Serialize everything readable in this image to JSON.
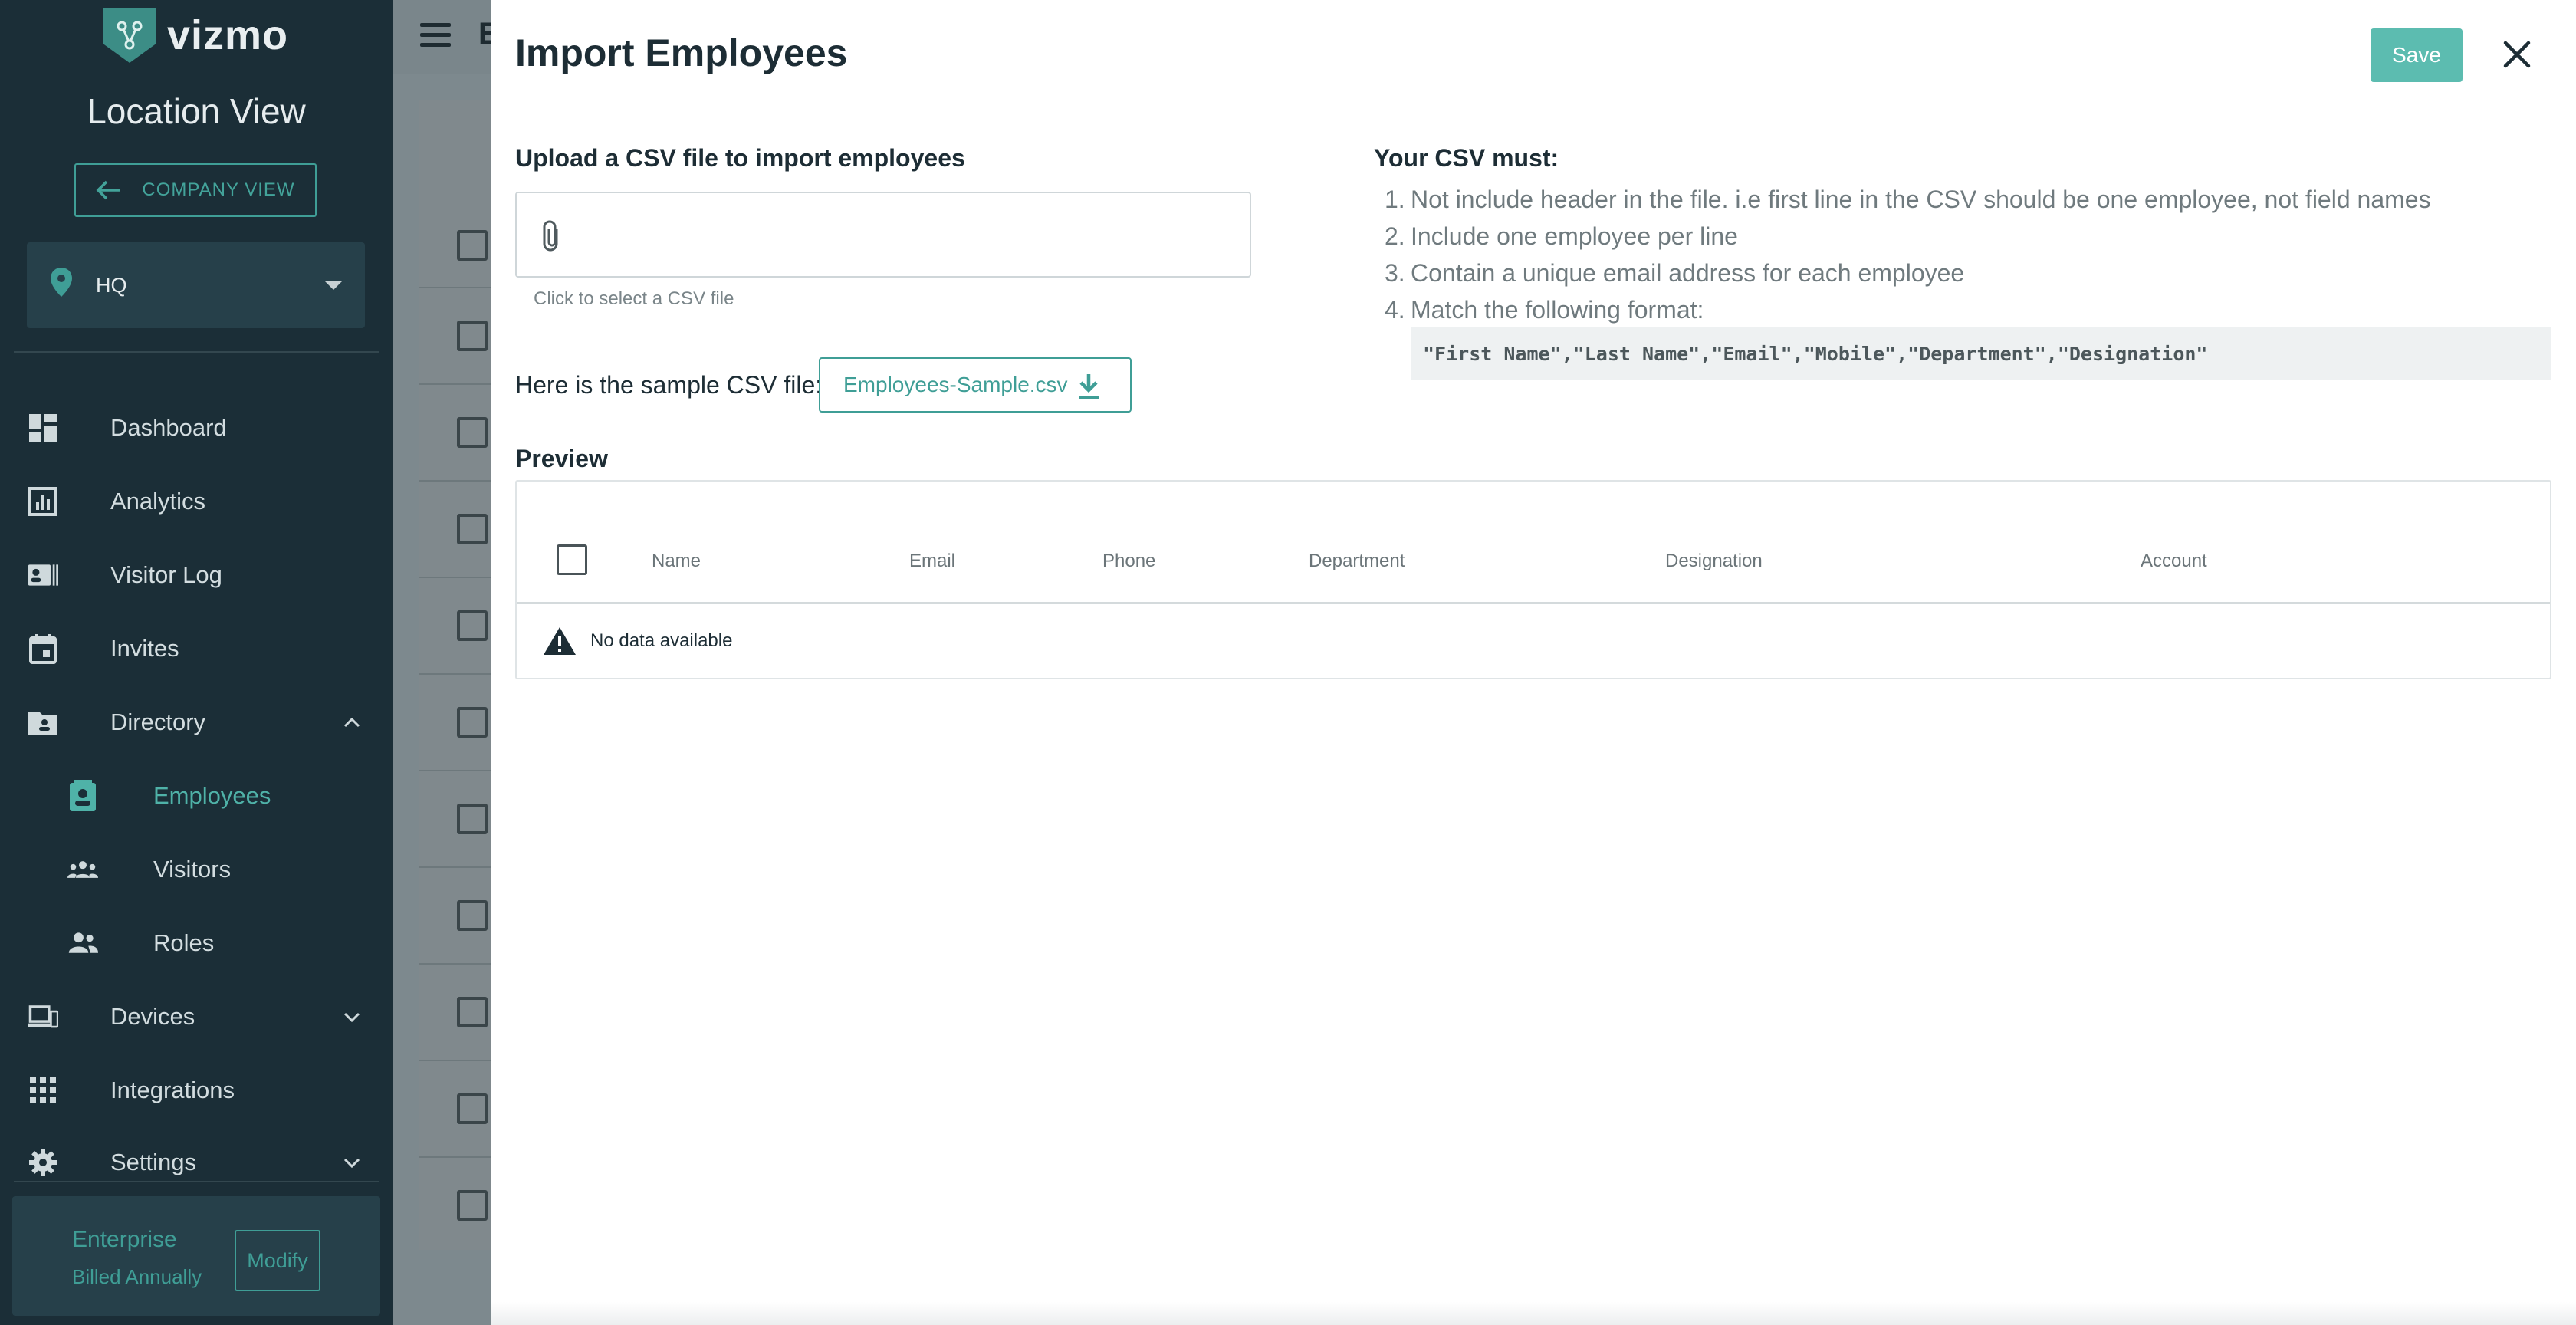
{
  "sidebar": {
    "brand": "vizmo",
    "view_title": "Location View",
    "company_view_label": "COMPANY VIEW",
    "location": "HQ",
    "nav": {
      "dashboard": "Dashboard",
      "analytics": "Analytics",
      "visitor_log": "Visitor Log",
      "invites": "Invites",
      "directory": "Directory",
      "employees": "Employees",
      "visitors": "Visitors",
      "roles": "Roles",
      "devices": "Devices",
      "integrations": "Integrations",
      "settings": "Settings"
    },
    "plan": {
      "name": "Enterprise",
      "billing": "Billed Annually",
      "modify_label": "Modify"
    }
  },
  "background_page": {
    "title_initial": "E"
  },
  "modal": {
    "title": "Import Employees",
    "save_label": "Save",
    "upload": {
      "label": "Upload a CSV file to import employees",
      "hint": "Click to select a CSV file"
    },
    "sample": {
      "label": "Here is the sample CSV file:",
      "file_name": "Employees-Sample.csv"
    },
    "rules": {
      "title": "Your CSV must:",
      "items": [
        "Not include header in the file. i.e first line in the CSV should be one employee, not field names",
        "Include one employee per line",
        "Contain a unique email address for each employee",
        "Match the following format:"
      ],
      "format": "\"First Name\",\"Last Name\",\"Email\",\"Mobile\",\"Department\",\"Designation\""
    },
    "preview": {
      "label": "Preview",
      "columns": [
        "Name",
        "Email",
        "Phone",
        "Department",
        "Designation",
        "Account"
      ],
      "empty_text": "No data available"
    }
  },
  "colors": {
    "sidebar_bg": "#1b2e37",
    "accent": "#3f9e96",
    "save_button": "#5cbcb0",
    "overlay": "#7d898e"
  }
}
